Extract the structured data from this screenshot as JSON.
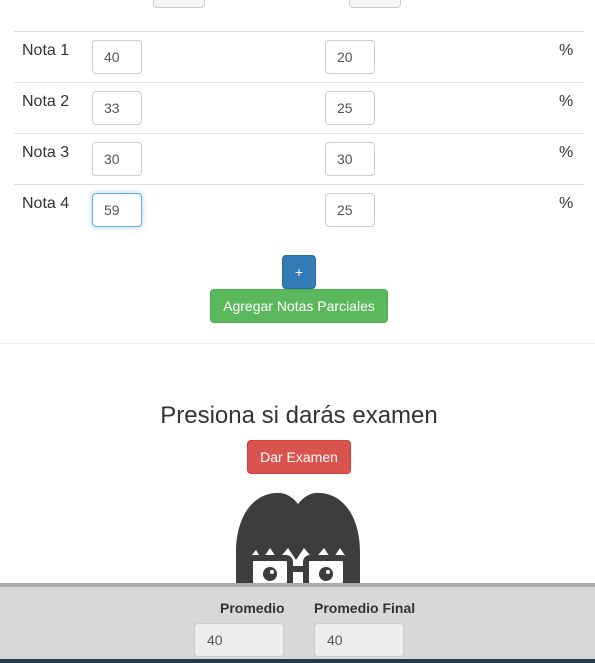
{
  "grades": [
    {
      "label": "Nota 1",
      "value": "40",
      "weight": "20",
      "unit": "%"
    },
    {
      "label": "Nota 2",
      "value": "33",
      "weight": "25",
      "unit": "%"
    },
    {
      "label": "Nota 3",
      "value": "30",
      "weight": "30",
      "unit": "%"
    },
    {
      "label": "Nota 4",
      "value": "59",
      "weight": "25",
      "unit": "%"
    }
  ],
  "actions": {
    "add_row_label": "+",
    "add_grades_label": "Agregar Notas Parciales"
  },
  "exam": {
    "heading": "Presiona si darás examen",
    "button_label": "Dar Examen"
  },
  "footer": {
    "average_label": "Promedio",
    "average_value": "40",
    "final_average_label": "Promedio Final",
    "final_average_value": "40"
  },
  "colors": {
    "primary": "#337ab7",
    "success": "#5cb85c",
    "danger": "#d9534f",
    "mascot": "#3d3d3d"
  },
  "icons": {
    "mascot": "nerd-mascot-with-glasses"
  }
}
